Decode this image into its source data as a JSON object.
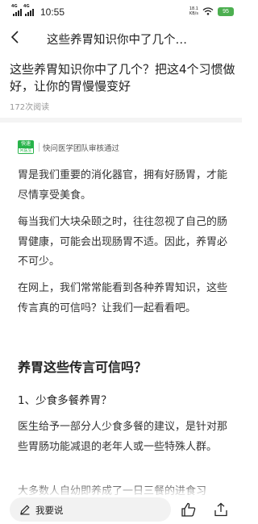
{
  "status_bar": {
    "time": "10:55",
    "sim1_tag": "4G",
    "sim2_tag": "4G",
    "net_speed": "18.1",
    "net_unit": "KB/s",
    "battery": "95"
  },
  "nav": {
    "title": "这些养胃知识你中了几个…"
  },
  "article": {
    "title": "这些养胃知识你中了几个？把这4个习惯做好，让你的胃慢慢变好",
    "read_count": "172次阅读",
    "audit": {
      "logo_top": "快速",
      "logo_bottom": "问医生",
      "text": "快问医学团队审核通过"
    },
    "paragraphs": [
      "胃是我们重要的消化器官，拥有好肠胃，才能尽情享受美食。",
      "每当我们大块朵颐之时，往往忽视了自己的肠胃健康，可能会出现肠胃不适。因此，养胃必不可少。",
      "在网上，我们常常能看到各种养胃知识，这些传言真的可信吗？让我们一起看看吧。"
    ],
    "section_heading": "养胃这些传言可信吗？",
    "subheading": "1、少食多餐养胃？",
    "section_paragraph": "医生给予一部分人少食多餐的建议，是针对那些胃肠功能减退的老年人或一些特殊人群。",
    "cut_paragraph": "大多数人自幼即养成了一日三餐的进食习"
  },
  "bottom_bar": {
    "comment_placeholder": "我要说"
  }
}
